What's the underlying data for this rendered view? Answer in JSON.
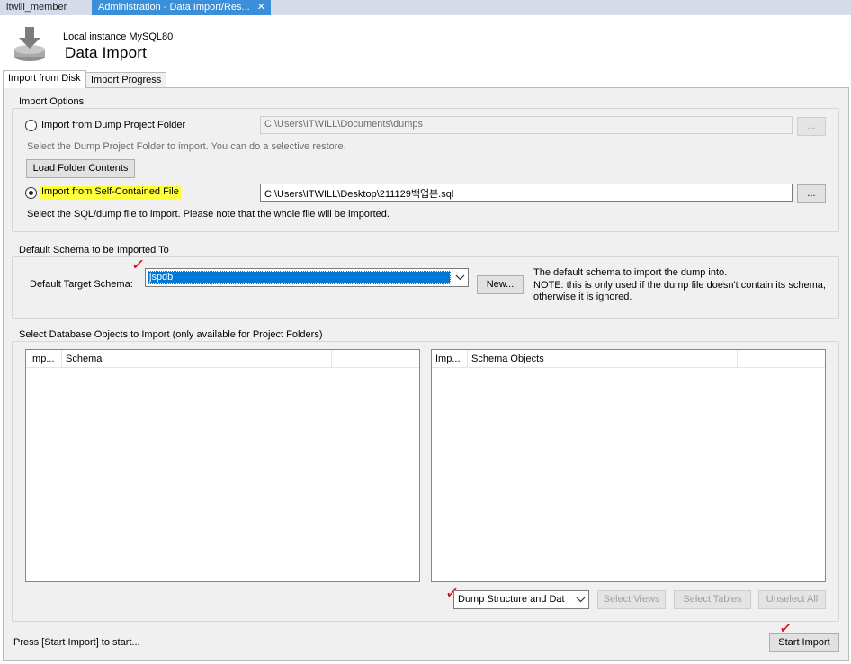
{
  "tabs": [
    {
      "label": "itwill_member"
    },
    {
      "label": "Administration - Data Import/Res..."
    }
  ],
  "header": {
    "subtitle": "Local instance MySQL80",
    "title": "Data Import"
  },
  "inner_tabs": [
    {
      "label": "Import from Disk"
    },
    {
      "label": "Import Progress"
    }
  ],
  "import_options": {
    "title": "Import Options",
    "dump_folder_radio": "Import from Dump Project Folder",
    "dump_folder_path": "C:\\Users\\ITWILL\\Documents\\dumps",
    "dump_folder_browse": "...",
    "dump_folder_hint": "Select the Dump Project Folder to import. You can do a selective restore.",
    "load_folder_button": "Load Folder Contents",
    "self_contained_radio": "Import from Self-Contained File",
    "self_contained_path": "C:\\Users\\ITWILL\\Desktop\\211129백업본.sql",
    "self_contained_browse": "...",
    "self_contained_hint": "Select the SQL/dump file to import. Please note that the whole file will be imported."
  },
  "default_schema": {
    "title": "Default Schema to be Imported To",
    "label": "Default Target Schema:",
    "selected": "jspdb",
    "new_button": "New...",
    "note_line1": "The default schema to import the dump into.",
    "note_line2": "NOTE: this is only used if the dump file doesn't contain its schema,",
    "note_line3": "otherwise it is ignored."
  },
  "objects": {
    "title": "Select Database Objects to Import (only available for Project Folders)",
    "left_columns": [
      "Imp...",
      "Schema"
    ],
    "right_columns": [
      "Imp...",
      "Schema Objects"
    ],
    "dump_mode": "Dump Structure and Dat",
    "select_views": "Select Views",
    "select_tables": "Select Tables",
    "unselect_all": "Unselect All"
  },
  "footer": {
    "status": "Press [Start Import] to start...",
    "start_button": "Start Import"
  },
  "colors": {
    "active_tab": "#3a8fd8",
    "highlight": "#ffff3a",
    "selection": "#0078d7",
    "annotation": "#e0001a"
  }
}
